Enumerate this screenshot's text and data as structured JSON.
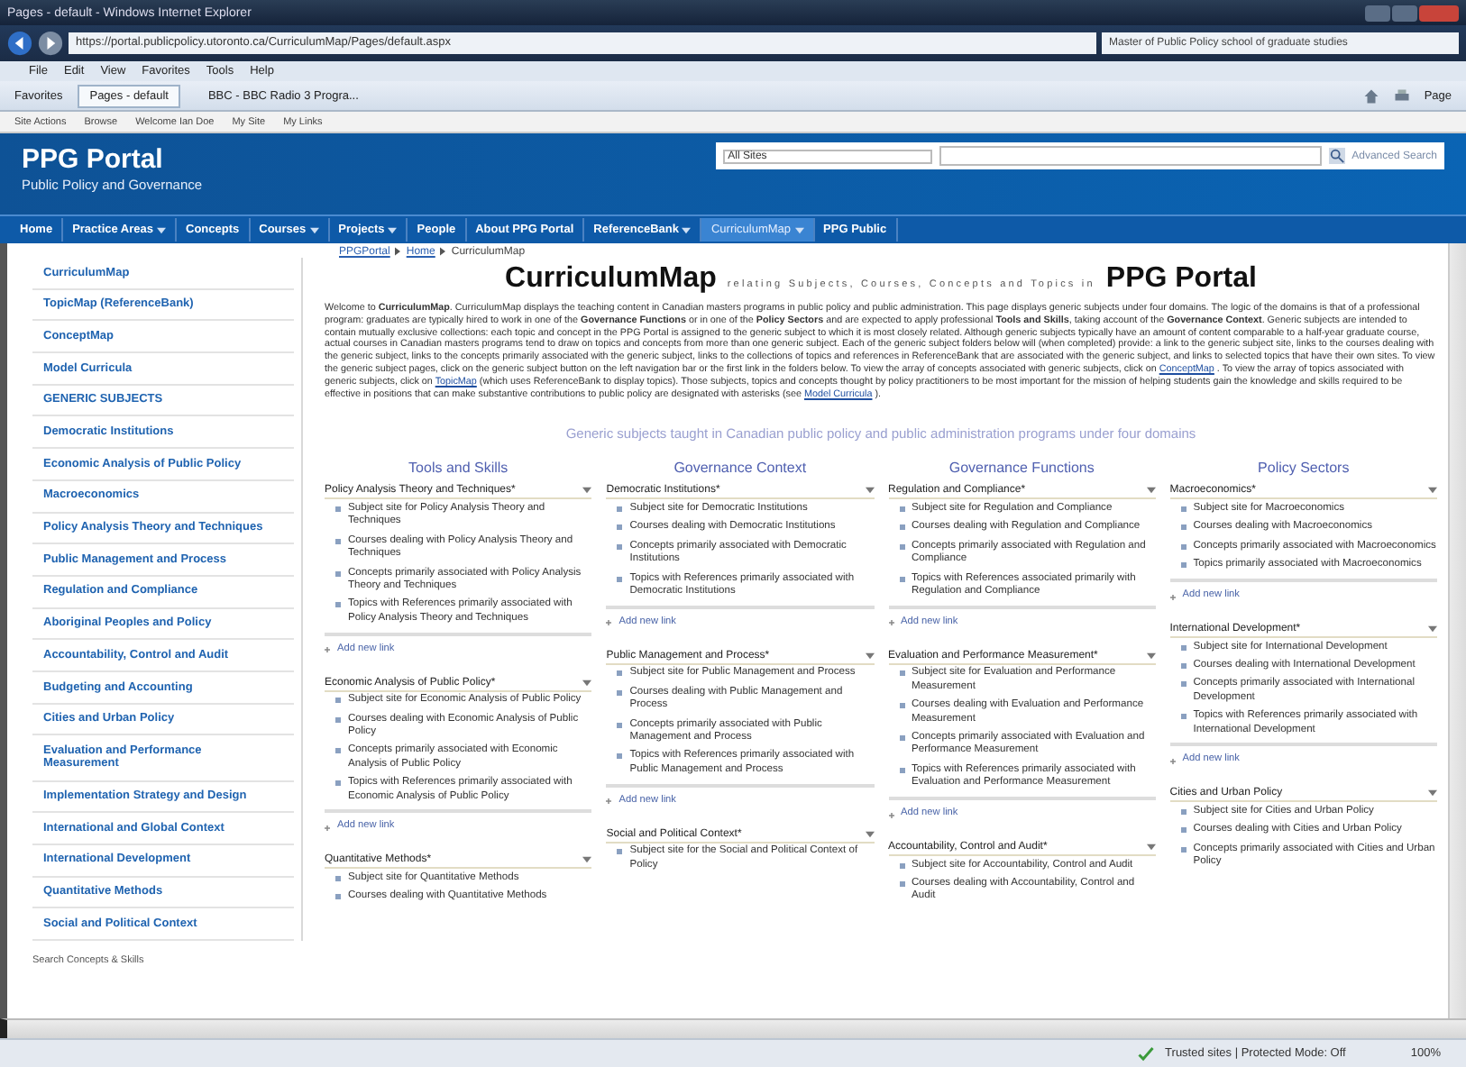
{
  "browser": {
    "title": "Pages - default - Windows Internet Explorer",
    "address": "https://portal.publicpolicy.utoronto.ca/CurriculumMap/Pages/default.aspx",
    "search_text": "Master of Public Policy school of graduate studies",
    "menu": [
      "File",
      "Edit",
      "View",
      "Favorites",
      "Tools",
      "Help"
    ],
    "favorites_label": "Favorites",
    "tabs": [
      {
        "label": "Pages - default",
        "selected": true
      },
      {
        "label": "BBC - BBC Radio 3 Progra...",
        "selected": false
      }
    ],
    "page_menu": "Page"
  },
  "site_bar": [
    "Site Actions",
    "Browse",
    "Welcome Ian Doe",
    "My Site",
    "My Links"
  ],
  "header": {
    "title": "PPG Portal",
    "subtitle": "Public Policy and Governance",
    "search_scope": "All Sites",
    "advanced_search": "Advanced Search"
  },
  "nav": [
    {
      "label": "Home",
      "dropdown": false,
      "selected": false
    },
    {
      "label": "Practice Areas",
      "dropdown": true,
      "selected": false
    },
    {
      "label": "Concepts",
      "dropdown": false,
      "selected": false
    },
    {
      "label": "Courses",
      "dropdown": true,
      "selected": false
    },
    {
      "label": "Projects",
      "dropdown": true,
      "selected": false
    },
    {
      "label": "People",
      "dropdown": false,
      "selected": false
    },
    {
      "label": "About PPG Portal",
      "dropdown": false,
      "selected": false
    },
    {
      "label": "ReferenceBank",
      "dropdown": true,
      "selected": false
    },
    {
      "label": "CurriculumMap",
      "dropdown": true,
      "selected": true
    },
    {
      "label": "PPG Public",
      "dropdown": false,
      "selected": false
    }
  ],
  "sidebar": {
    "items": [
      "CurriculumMap",
      "TopicMap (ReferenceBank)",
      "ConceptMap",
      "Model Curricula",
      "GENERIC SUBJECTS",
      "Democratic Institutions",
      "Economic Analysis of Public Policy",
      "Macroeconomics",
      "Policy Analysis Theory and Techniques",
      "Public Management and Process",
      "Regulation and Compliance",
      "Aboriginal Peoples and Policy",
      "Accountability, Control and Audit",
      "Budgeting and Accounting",
      "Cities and Urban Policy",
      "Evaluation and Performance Measurement",
      "Implementation Strategy and Design",
      "International and Global Context",
      "International Development",
      "Quantitative Methods",
      "Social and Political Context"
    ],
    "search_label": "Search Concepts & Skills"
  },
  "breadcrumb": [
    "PPGPortal",
    "Home",
    "CurriculumMap"
  ],
  "page_title": {
    "name": "CurriculumMap",
    "tagline": "relating Subjects, Courses, Concepts and Topics in",
    "portal": "PPG Portal"
  },
  "intro": [
    {
      "kind": "text",
      "text": "Welcome to **CurriculumMap**. CurriculumMap displays the teaching content in Canadian masters programs in public policy and public administration. This page displays generic subjects under four domains. The logic of the domains is that of a professional program: graduates are typically hired to work in one of the **Governance Functions** or in one of the **Policy Sectors** and are expected to apply professional **Tools and Skills**, taking account of the **Governance Context**. Generic subjects are intended to contain mutually exclusive collections: each topic and concept in the PPG Portal is assigned to the generic subject to which it is most closely related. Although generic subjects typically have an amount of content comparable to a half-year graduate course, actual courses in Canadian masters programs tend to draw on topics and concepts from more than one generic subject. Each of the generic subject folders below will (when completed) provide: a link to the generic subject site, links to the courses dealing with the generic subject, links to the concepts primarily associated with the generic subject, links to the collections of topics and references in ReferenceBank that are associated with the generic subject, and links to selected topics that have their own sites. To view the generic subject pages, click on the generic subject button on the left navigation bar or the first link in the folders below. To view the array of concepts associated with generic subjects, click on"
    },
    {
      "kind": "link",
      "text": "ConceptMap"
    },
    {
      "kind": "text",
      "text": ". To view the array of topics associated with generic subjects, click on"
    },
    {
      "kind": "link",
      "text": "TopicMap"
    },
    {
      "kind": "text",
      "text": "(which uses ReferenceBank to display topics). Those subjects, topics and concepts thought by policy practitioners to be most important for the mission of helping students gain the knowledge and skills required to be effective in positions that can make substantive contributions to public policy are designated with asterisks (see"
    },
    {
      "kind": "link",
      "text": "Model Curricula"
    },
    {
      "kind": "text",
      "text": ")."
    }
  ],
  "domains_heading": "Generic subjects taught in Canadian public policy and public administration programs under four domains",
  "domains": [
    {
      "title": "Tools and Skills",
      "sections": [
        {
          "title": "Policy Analysis Theory and Techniques*",
          "links": [
            "Subject site for Policy Analysis Theory and Techniques",
            "Courses dealing with Policy Analysis Theory and Techniques",
            "Concepts primarily associated with Policy Analysis Theory and Techniques",
            "Topics with References primarily associated with Policy Analysis Theory and Techniques"
          ],
          "add_link": "Add new link"
        },
        {
          "title": "Economic Analysis of Public Policy*",
          "links": [
            "Subject site for Economic Analysis of Public Policy",
            "Courses dealing with Economic Analysis of Public Policy",
            "Concepts primarily associated with Economic Analysis of Public Policy",
            "Topics with References primarily associated with Economic Analysis of Public Policy"
          ],
          "add_link": "Add new link"
        },
        {
          "title": "Quantitative Methods*",
          "links": [
            "Subject site for Quantitative Methods",
            "Courses dealing with Quantitative Methods"
          ]
        }
      ]
    },
    {
      "title": "Governance Context",
      "sections": [
        {
          "title": "Democratic Institutions*",
          "links": [
            "Subject site for Democratic Institutions",
            "Courses dealing with Democratic Institutions",
            "Concepts primarily associated with Democratic Institutions",
            "Topics with References primarily associated with Democratic Institutions"
          ],
          "add_link": "Add new link"
        },
        {
          "title": "Public Management and Process*",
          "links": [
            "Subject site for Public Management and Process",
            "Courses dealing with Public Management and Process",
            "Concepts primarily associated with Public Management and Process",
            "Topics with References primarily associated with Public Management and Process"
          ],
          "add_link": "Add new link"
        },
        {
          "title": "Social and Political Context*",
          "links": [
            "Subject site for the Social and Political Context of Policy"
          ]
        }
      ]
    },
    {
      "title": "Governance Functions",
      "sections": [
        {
          "title": "Regulation and Compliance*",
          "links": [
            "Subject site for Regulation and Compliance",
            "Courses dealing with Regulation and Compliance",
            "Concepts primarily associated with Regulation and Compliance",
            "Topics with References associated primarily with Regulation and Compliance"
          ],
          "add_link": "Add new link"
        },
        {
          "title": "Evaluation and Performance Measurement*",
          "links": [
            "Subject site for Evaluation and Performance Measurement",
            "Courses dealing with Evaluation and Performance Measurement",
            "Concepts primarily associated with Evaluation and Performance Measurement",
            "Topics with References primarily associated with Evaluation and Performance Measurement"
          ],
          "add_link": "Add new link"
        },
        {
          "title": "Accountability, Control and Audit*",
          "links": [
            "Subject site for Accountability, Control and Audit",
            "Courses dealing with Accountability, Control and Audit"
          ]
        }
      ]
    },
    {
      "title": "Policy Sectors",
      "sections": [
        {
          "title": "Macroeconomics*",
          "links": [
            "Subject site for Macroeconomics",
            "Courses dealing with Macroeconomics",
            "Concepts primarily associated with Macroeconomics",
            "Topics primarily associated with Macroeconomics"
          ],
          "add_link": "Add new link"
        },
        {
          "title": "International Development*",
          "links": [
            "Subject site for International Development",
            "Courses dealing with International Development",
            "Concepts primarily associated with International Development",
            "Topics with References primarily associated with International Development"
          ],
          "add_link": "Add new link"
        },
        {
          "title": "Cities and Urban Policy",
          "links": [
            "Subject site for Cities and Urban Policy",
            "Courses dealing with Cities and Urban Policy",
            "Concepts primarily associated with Cities and Urban Policy"
          ]
        }
      ]
    }
  ],
  "status_bar": {
    "zone": "Trusted sites | Protected Mode: Off",
    "zoom": "100%"
  }
}
